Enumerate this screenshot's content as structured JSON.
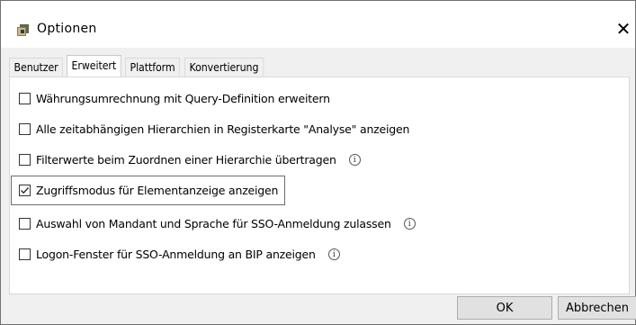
{
  "window": {
    "title": "Optionen",
    "title_icon": "options-app-icon",
    "close_label": "✕"
  },
  "tabs": [
    {
      "label": "Benutzer",
      "active": false
    },
    {
      "label": "Erweitert",
      "active": true
    },
    {
      "label": "Plattform",
      "active": false
    },
    {
      "label": "Konvertierung",
      "active": false
    }
  ],
  "options": [
    {
      "label": "Währungsumrechnung mit Query-Definition erweitern",
      "checked": false,
      "info": false
    },
    {
      "label": "Alle zeitabhängigen Hierarchien in Registerkarte \"Analyse\" anzeigen",
      "checked": false,
      "info": false
    },
    {
      "label": "Filterwerte beim Zuordnen einer Hierarchie übertragen",
      "checked": false,
      "info": true
    },
    {
      "label": "Zugriffsmodus für Elementanzeige anzeigen",
      "checked": true,
      "info": false,
      "focused": true
    },
    {
      "label": "Auswahl von Mandant und Sprache für SSO-Anmeldung zulassen",
      "checked": false,
      "info": true
    },
    {
      "label": "Logon-Fenster für SSO-Anmeldung an BIP anzeigen",
      "checked": false,
      "info": true
    }
  ],
  "info_glyph": "i",
  "buttons": {
    "ok": "OK",
    "cancel": "Abbrechen"
  }
}
